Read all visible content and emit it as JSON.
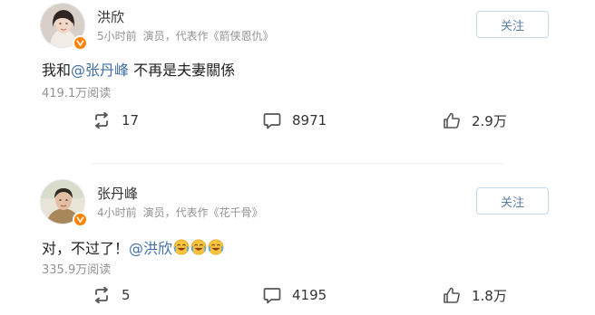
{
  "posts": [
    {
      "author": "洪欣",
      "time": "5小时前",
      "bio": "演员，代表作《箭侠恩仇》",
      "follow_label": "关注",
      "text_before": "我和",
      "mention": "@张丹峰",
      "text_after": " 不再是夫妻關係",
      "reads": "419.1万阅读",
      "reposts": "17",
      "comments": "8971",
      "likes": "2.9万"
    },
    {
      "author": "张丹峰",
      "time": "4小时前",
      "bio": "演员，代表作《花千骨》",
      "follow_label": "关注",
      "text_before": "对，不过了！",
      "mention": "@洪欣",
      "text_after": "",
      "emojis": [
        "cry-laugh-emoji",
        "cry-laugh-emoji",
        "cry-laugh-emoji"
      ],
      "reads": "335.9万阅读",
      "reposts": "5",
      "comments": "4195",
      "likes": "1.8万"
    }
  ],
  "colors": {
    "mention": "#416ea6",
    "follow_text": "#5a7ea6",
    "follow_border": "#c4d8ec",
    "verified_badge": "#ff8200",
    "meta_text": "#939393"
  },
  "icons": {
    "repost": "repost-icon",
    "comment": "comment-icon",
    "like": "thumbs-up-icon",
    "verified": "verified-v-icon"
  }
}
